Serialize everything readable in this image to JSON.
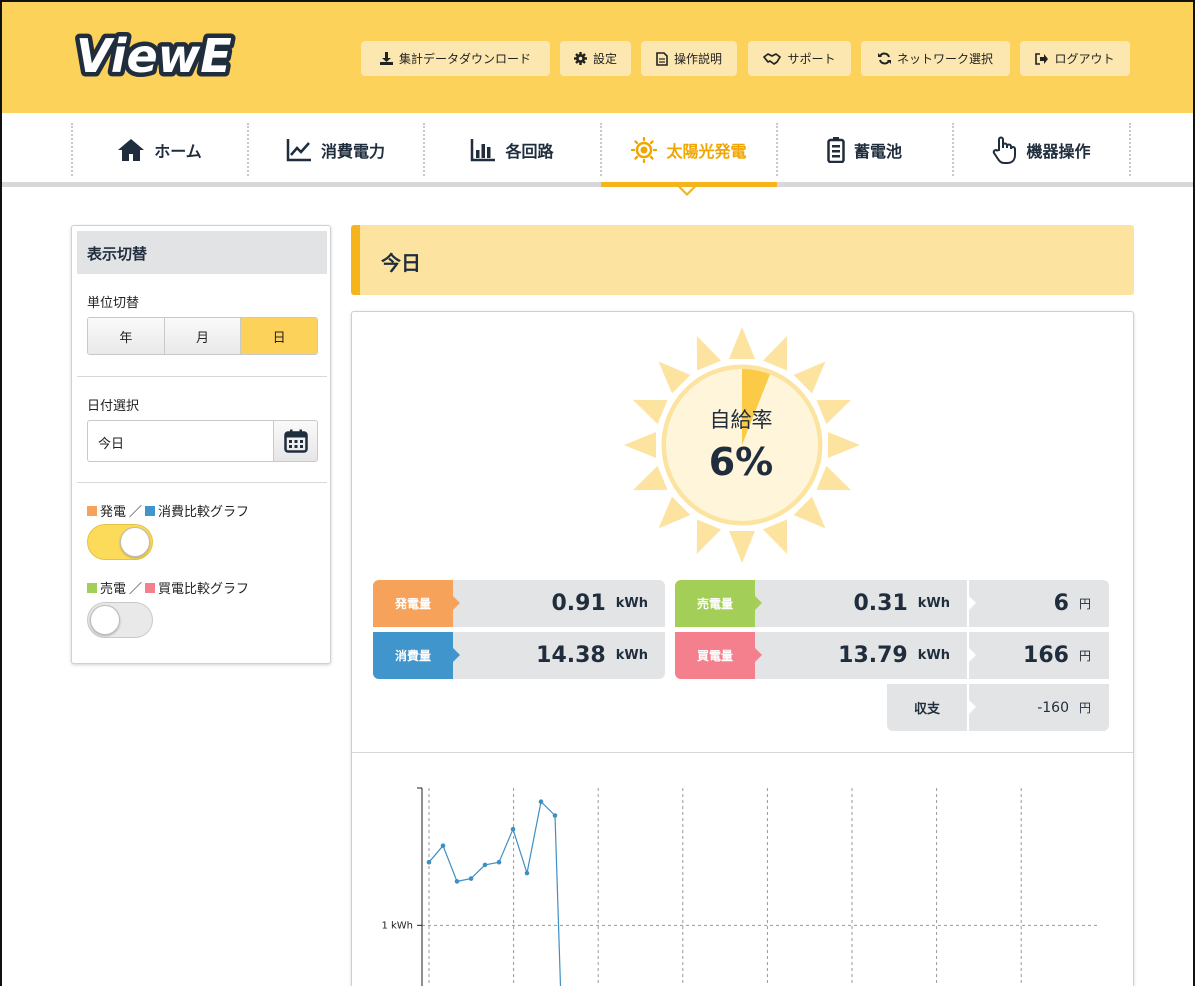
{
  "app": {
    "logo_text": "ViewE"
  },
  "header": {
    "buttons": [
      {
        "label": "集計データダウンロード",
        "icon": "download-icon"
      },
      {
        "label": "設定",
        "icon": "gear-icon"
      },
      {
        "label": "操作説明",
        "icon": "document-icon"
      },
      {
        "label": "サポート",
        "icon": "handshake-icon"
      },
      {
        "label": "ネットワーク選択",
        "icon": "refresh-icon"
      },
      {
        "label": "ログアウト",
        "icon": "logout-icon"
      }
    ]
  },
  "nav": {
    "items": [
      {
        "label": "ホーム",
        "icon": "home-icon"
      },
      {
        "label": "消費電力",
        "icon": "line-chart-icon"
      },
      {
        "label": "各回路",
        "icon": "bar-chart-icon"
      },
      {
        "label": "太陽光発電",
        "icon": "sun-icon",
        "active": true
      },
      {
        "label": "蓄電池",
        "icon": "battery-icon"
      },
      {
        "label": "機器操作",
        "icon": "hand-pointer-icon"
      }
    ]
  },
  "sidebar": {
    "title": "表示切替",
    "unit_label": "単位切替",
    "unit_options": [
      "年",
      "月",
      "日"
    ],
    "unit_selected": "日",
    "date_label": "日付選択",
    "date_value": "今日",
    "graph1_label_a": "発電",
    "graph1_sep": "／",
    "graph1_label_b": "消費比較グラフ",
    "graph1_on": true,
    "graph2_label_a": "売電",
    "graph2_sep": "／",
    "graph2_label_b": "買電比較グラフ",
    "graph2_on": false
  },
  "main": {
    "period_title": "今日",
    "self_sufficiency": {
      "label": "自給率",
      "value": "6%",
      "fraction": 0.06
    },
    "stats": {
      "generation": {
        "label": "発電量",
        "value": "0.91",
        "unit": "kWh"
      },
      "consumption": {
        "label": "消費量",
        "value": "14.38",
        "unit": "kWh"
      },
      "sold": {
        "label": "売電量",
        "value": "0.31",
        "unit": "kWh",
        "yen": "6",
        "yen_unit": "円"
      },
      "bought": {
        "label": "買電量",
        "value": "13.79",
        "unit": "kWh",
        "yen": "166",
        "yen_unit": "円"
      },
      "balance": {
        "label": "収支",
        "value": "-160",
        "unit": "円"
      }
    }
  },
  "colors": {
    "header": "#fdd25b",
    "accent": "#f5b41c",
    "generation": "#f7a25a",
    "consumption": "#3f95cc",
    "sold": "#a3cf59",
    "bought": "#f47f8d",
    "line": "#3f8fc4"
  },
  "chart_data": {
    "type": "line",
    "ytick_label": "1 kWh",
    "ytick_value": 1,
    "ylim": [
      0,
      1.5
    ],
    "x": [
      0,
      1,
      2,
      3,
      4,
      5,
      6,
      7,
      8,
      9
    ],
    "series": [
      {
        "values": [
          1.23,
          1.29,
          1.16,
          1.17,
          1.22,
          1.23,
          1.35,
          1.19,
          1.45,
          1.4
        ]
      }
    ],
    "grid": true
  }
}
